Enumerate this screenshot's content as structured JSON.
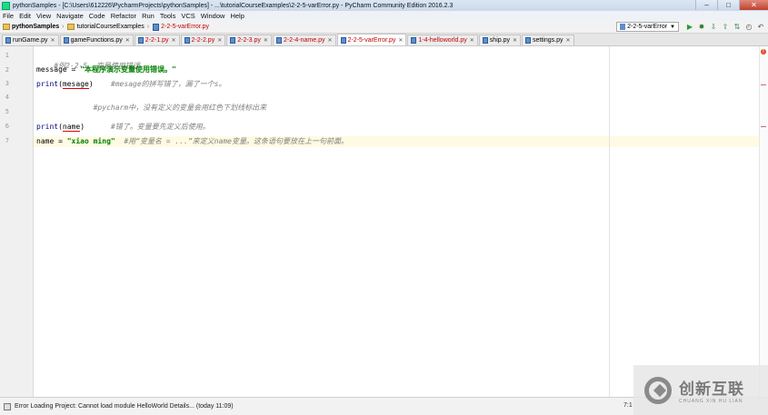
{
  "window": {
    "title": "pythonSamples - [C:\\Users\\612226\\PycharmProjects\\pythonSamples] - ...\\tutorialCourseExamples\\2-2-5-varError.py - PyCharm Community Edition 2016.2.3",
    "minimize": "–",
    "maximize": "□",
    "close": "✕"
  },
  "menu": [
    "File",
    "Edit",
    "View",
    "Navigate",
    "Code",
    "Refactor",
    "Run",
    "Tools",
    "VCS",
    "Window",
    "Help"
  ],
  "breadcrumb": {
    "project": "pythonSamples",
    "folder": "tutorialCourseExamples",
    "file": "2-2-5-varError.py"
  },
  "run_config": "2-2-5-varError",
  "tabs": [
    {
      "label": "runGame.py",
      "style": "normal"
    },
    {
      "label": "gameFunctions.py",
      "style": "normal"
    },
    {
      "label": "2-2-1.py",
      "style": "red"
    },
    {
      "label": "2-2-2.py",
      "style": "red"
    },
    {
      "label": "2-2-3.py",
      "style": "red"
    },
    {
      "label": "2-2-4-name.py",
      "style": "red"
    },
    {
      "label": "2-2-5-varError.py",
      "style": "active"
    },
    {
      "label": "1-4-helloworld.py",
      "style": "red"
    },
    {
      "label": "ship.py",
      "style": "normal"
    },
    {
      "label": "settings.py",
      "style": "normal"
    }
  ],
  "code": {
    "line1": "#例2-2-5  变量使用错误",
    "line2_a": "message = ",
    "line2_b": "\"本程序演示变量使用错误。\"",
    "line3_a": "print",
    "line3_b": "(",
    "line3_c": "mesage",
    "line3_d": ")",
    "line3_e": "    #mesage的拼写错了，漏了一个s。",
    "line4": "         #pycharm中，没有定义的变量会用红色下划线标出来",
    "line6_a": "print",
    "line6_b": "(",
    "line6_c": "name",
    "line6_d": ")",
    "line6_e": "      #错了。变量要先定义后使用。",
    "line7_a": "name = ",
    "line7_b": "\"xiao ming\"",
    "line7_c": "  #用“变量名 = ...”来定义name变量。这条语句要放在上一句前面。"
  },
  "line_numbers": [
    "1",
    "2",
    "3",
    "4",
    "5",
    "6",
    "7"
  ],
  "status": {
    "message": "Error Loading Project: Cannot load module HelloWorld Details... (today 11:09)",
    "position": "7:1"
  },
  "watermark": {
    "cn": "创新互联",
    "en": "CHUANG XIN HU LIAN"
  }
}
